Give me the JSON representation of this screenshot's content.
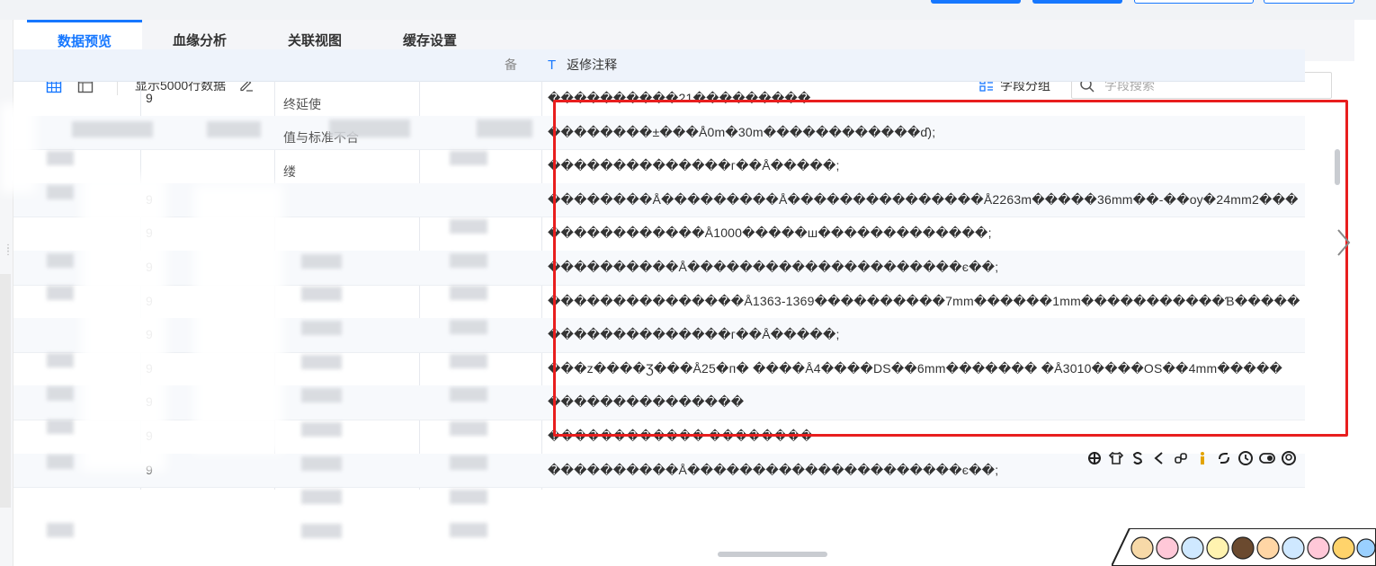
{
  "tabs": [
    {
      "label": "数据预览",
      "active": true
    },
    {
      "label": "血缘分析",
      "active": false
    },
    {
      "label": "关联视图",
      "active": false
    },
    {
      "label": "缓存设置",
      "active": false
    }
  ],
  "toolbar": {
    "rows_label": "显示5000行数据",
    "group_label": "字段分组",
    "search_placeholder": "字段搜索"
  },
  "table": {
    "header_partial": "备",
    "remark_header": "返修注释",
    "partial_cells": {
      "r1": "终延使",
      "r2": "值与标准不合",
      "r3": "缕"
    },
    "rows": [
      {
        "num": "9",
        "remark": "����������21���������"
      },
      {
        "num": "",
        "remark": "��������±���Å0m�30m������������ɗ);"
      },
      {
        "num": "",
        "remark": "��������������г��Å�����;"
      },
      {
        "num": "9",
        "remark": "��������Å���������Å���������������Å2263m�����36mm��-��оу�24mm2���"
      },
      {
        "num": "9",
        "remark": "������������Å1000�����ш�������������;"
      },
      {
        "num": "9",
        "remark": "����������Å���������������������є��;"
      },
      {
        "num": "9",
        "remark": "���������������Å1363-1369����������7mm������1mm�����������Ɓ�����"
      },
      {
        "num": "9",
        "remark": "��������������г��Å�����;"
      },
      {
        "num": "9",
        "remark": "���z����Ʒ���Å25�п� ����Å4����DS��6mm������� �Å3010����OS��4mm�����"
      },
      {
        "num": "9",
        "remark": "���������������"
      },
      {
        "num": "9",
        "remark": "������������ ��������"
      },
      {
        "num": "9",
        "remark": "����������Å���������������������є��;"
      }
    ]
  },
  "colors": {
    "accent": "#1677ff",
    "highlight": "#e81e1e"
  }
}
